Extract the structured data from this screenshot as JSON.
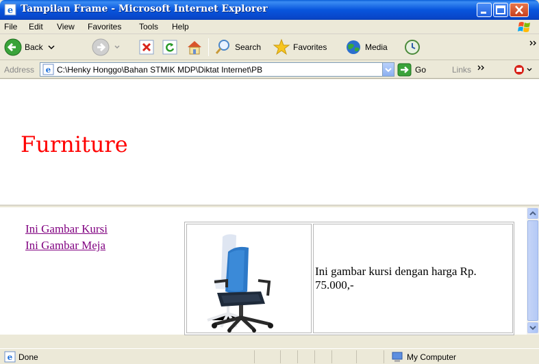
{
  "window": {
    "title": "Tampilan Frame - Microsoft Internet Explorer"
  },
  "menu": {
    "items": [
      "File",
      "Edit",
      "View",
      "Favorites",
      "Tools",
      "Help"
    ]
  },
  "toolbar": {
    "back_label": "Back",
    "search_label": "Search",
    "favorites_label": "Favorites",
    "media_label": "Media"
  },
  "addressbar": {
    "label": "Address",
    "value": "C:\\Henky Honggo\\Bahan STMIK MDP\\Diktat Internet\\PB",
    "go_label": "Go",
    "links_label": "Links"
  },
  "content": {
    "heading": "Furniture",
    "nav_links": [
      "Ini Gambar Kursi",
      "Ini Gambar Meja"
    ],
    "description": "Ini gambar kursi dengan harga Rp. 75.000,-"
  },
  "status": {
    "text": "Done",
    "zone": "My Computer"
  },
  "colors": {
    "heading": "#ff0000",
    "visited_link": "#800080",
    "titlebar": "#0855dd"
  }
}
